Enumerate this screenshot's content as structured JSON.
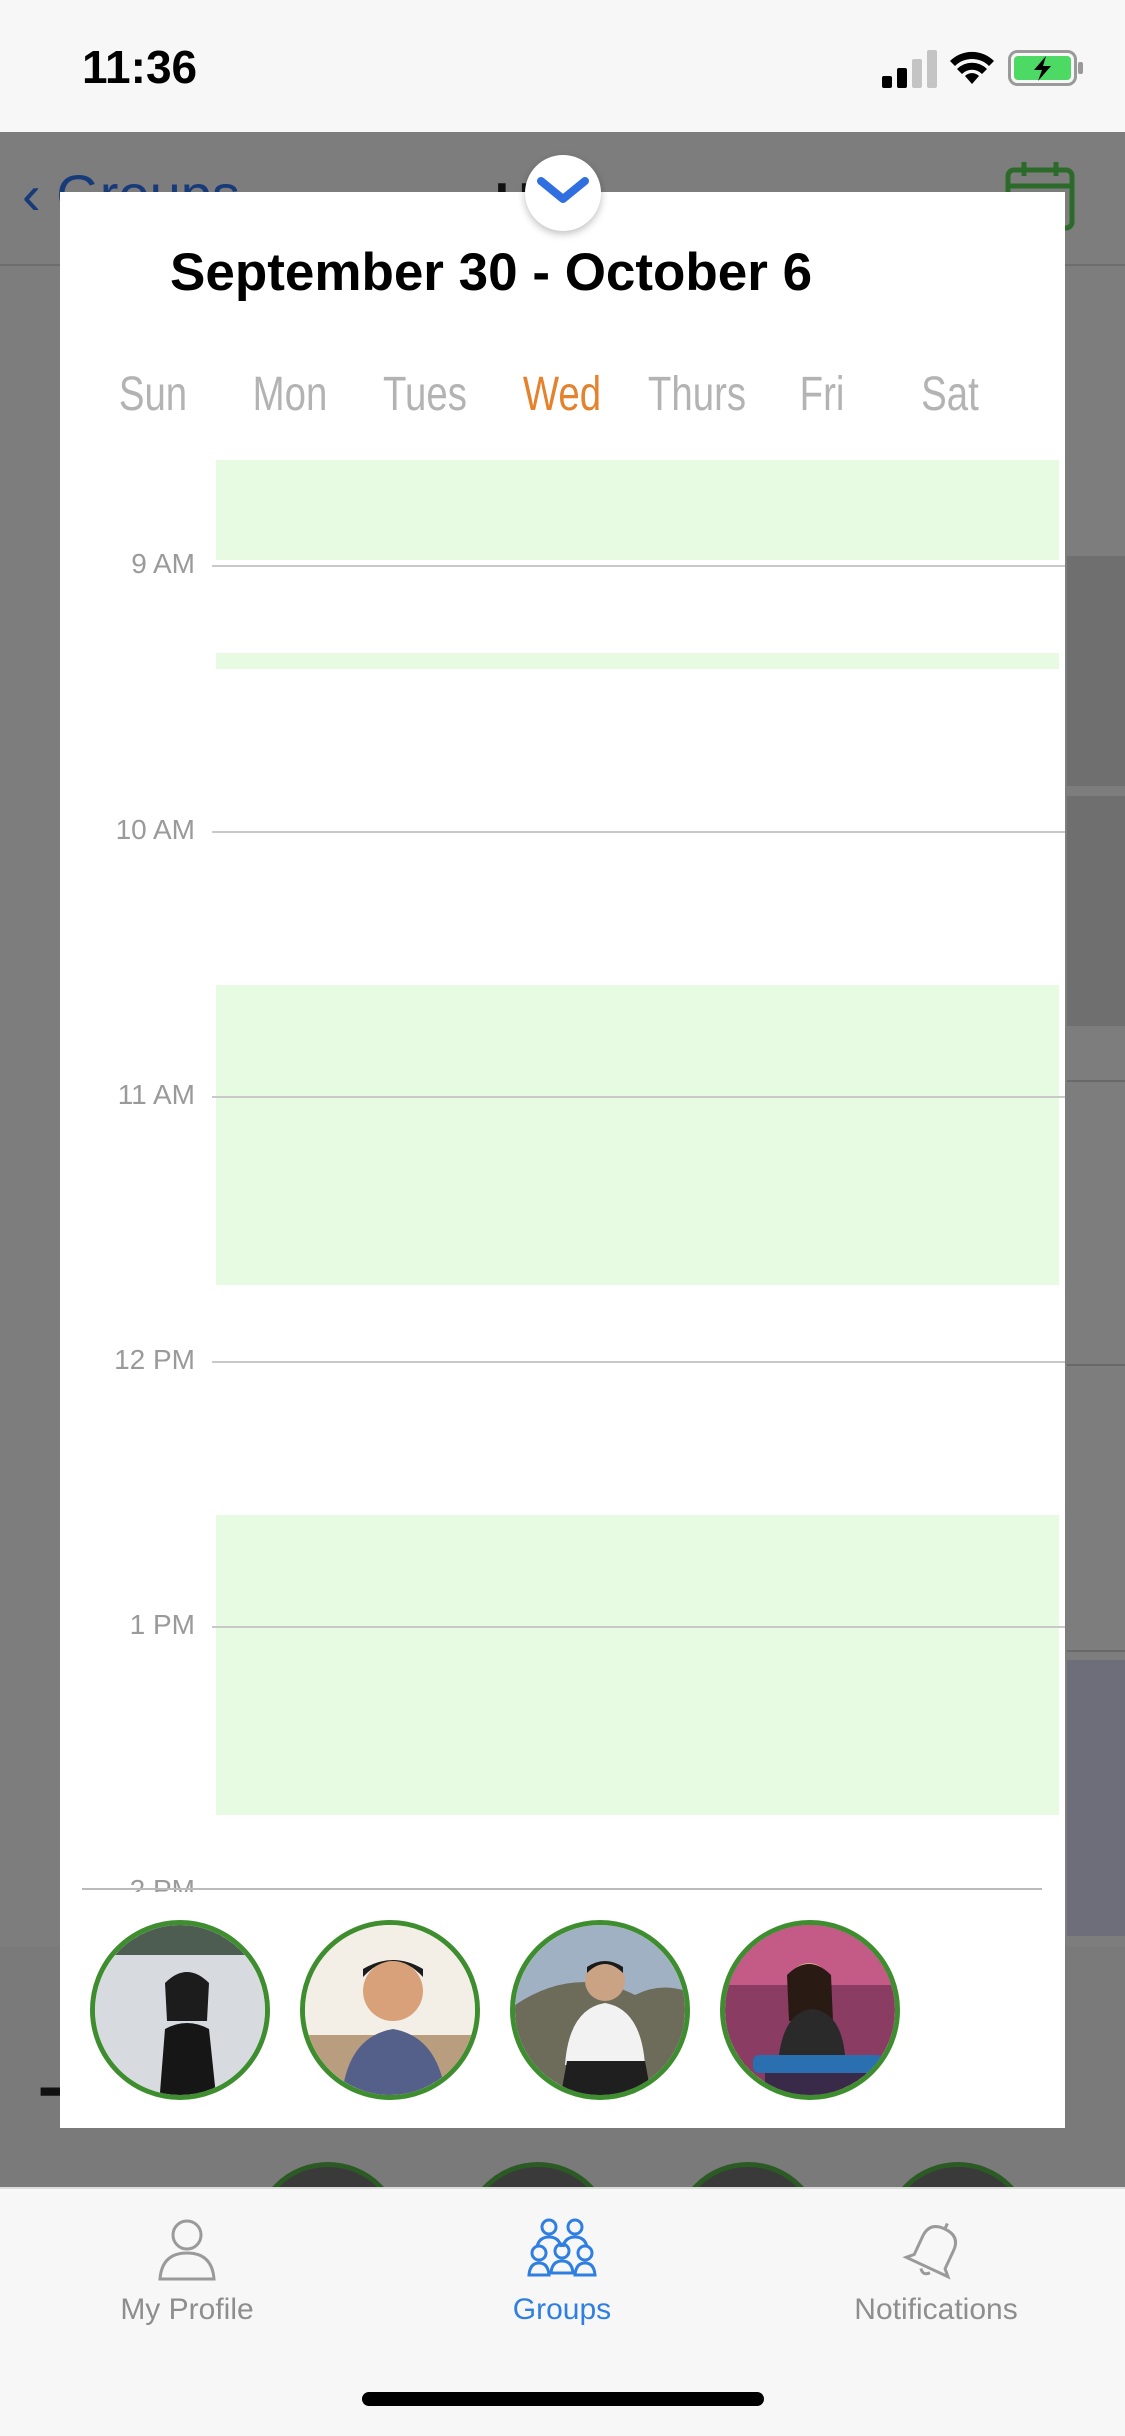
{
  "status_bar": {
    "time": "11:36"
  },
  "background": {
    "back_label": "Groups",
    "title_peek": "U S"
  },
  "sheet": {
    "title": "September 30 - October 6",
    "days": [
      "Sun",
      "Mon",
      "Tues",
      "Wed",
      "Thurs",
      "Fri",
      "Sat"
    ],
    "selected_day": "Wed",
    "hour_labels": [
      "9 AM",
      "10 AM",
      "11 AM",
      "12 PM",
      "1 PM",
      "2 PM"
    ],
    "available_color": "#e7fbe3",
    "members": [
      {
        "name": "member-1"
      },
      {
        "name": "member-2"
      },
      {
        "name": "member-3"
      },
      {
        "name": "member-4"
      }
    ]
  },
  "tab_bar": {
    "items": [
      {
        "label": "My Profile",
        "icon": "person-icon"
      },
      {
        "label": "Groups",
        "icon": "group-icon"
      },
      {
        "label": "Notifications",
        "icon": "bell-icon"
      }
    ],
    "active": "Groups",
    "active_color": "#2f7fe2"
  }
}
